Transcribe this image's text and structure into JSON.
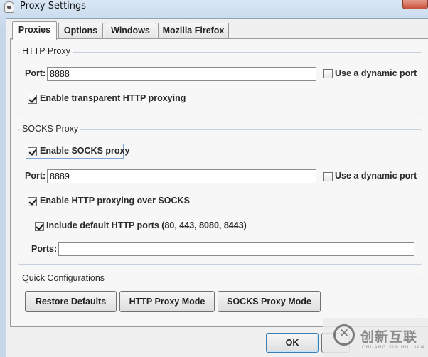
{
  "window": {
    "title": "Proxy Settings"
  },
  "tabs": [
    {
      "label": "Proxies",
      "active": true
    },
    {
      "label": "Options",
      "active": false
    },
    {
      "label": "Windows",
      "active": false
    },
    {
      "label": "Mozilla Firefox",
      "active": false
    }
  ],
  "http_proxy": {
    "legend": "HTTP Proxy",
    "port_label": "Port:",
    "port_value": "8888",
    "dynamic_port_label": "Use a dynamic port",
    "dynamic_port_checked": false,
    "transparent_label": "Enable transparent HTTP proxying",
    "transparent_checked": true
  },
  "socks_proxy": {
    "legend": "SOCKS Proxy",
    "enable_label": "Enable SOCKS proxy",
    "enable_checked": true,
    "port_label": "Port:",
    "port_value": "8889",
    "dynamic_port_label": "Use a dynamic port",
    "dynamic_port_checked": false,
    "http_over_socks_label": "Enable HTTP proxying over SOCKS",
    "http_over_socks_checked": true,
    "include_default_ports_label": "Include default HTTP ports (80, 443, 8080, 8443)",
    "include_default_ports_checked": true,
    "ports_label": "Ports:",
    "ports_value": ""
  },
  "quick_config": {
    "legend": "Quick Configurations",
    "restore_defaults": "Restore Defaults",
    "http_proxy_mode": "HTTP Proxy Mode",
    "socks_proxy_mode": "SOCKS Proxy Mode"
  },
  "dialog_buttons": {
    "ok": "OK"
  },
  "watermark": {
    "cn": "创新互联",
    "en": "CHUANG XIN HU LIAN"
  }
}
